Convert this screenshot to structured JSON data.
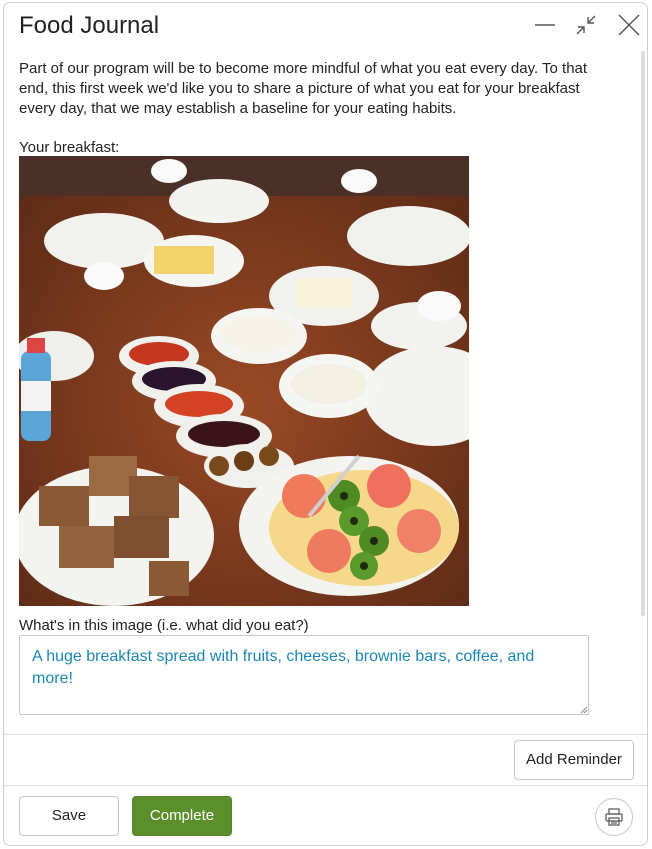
{
  "window": {
    "title": "Food Journal",
    "minimize_icon": "minimize-icon",
    "collapse_icon": "collapse-arrows-icon",
    "close_icon": "close-icon"
  },
  "intro_text": "Part of our program will be to become more mindful of what you eat every day. To that end, this first week we'd like you to share a picture of what you eat for your breakfast every day, that we may establish a baseline for your eating habits.",
  "breakfast_label": "Your breakfast:",
  "photo": {
    "subject": "breakfast table photo"
  },
  "question_label": "What's in this image (i.e. what did you eat?)",
  "answer_value": "A huge breakfast spread with fruits, cheeses, brownie bars, coffee, and more!",
  "buttons": {
    "add_reminder": "Add Reminder",
    "save": "Save",
    "complete": "Complete",
    "print_icon": "printer-icon"
  },
  "colors": {
    "primary": "#5a8f2c",
    "answer_text": "#1a87b3"
  }
}
